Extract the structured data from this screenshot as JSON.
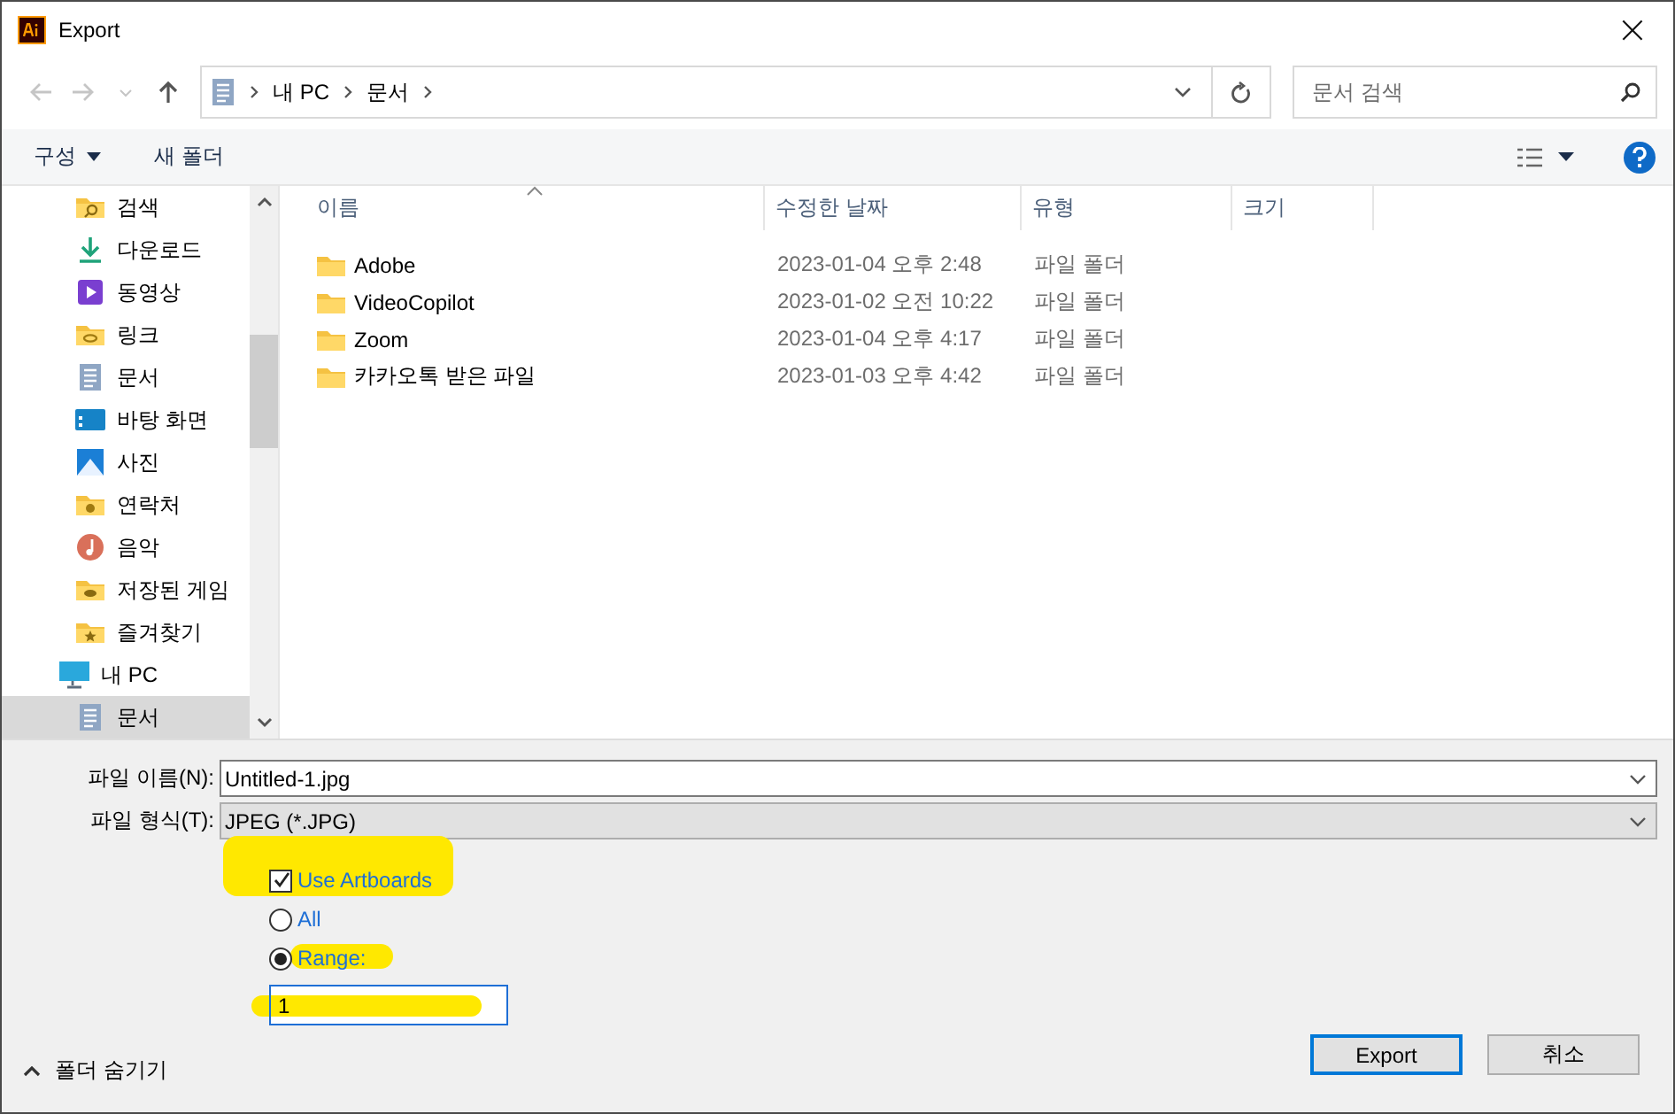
{
  "window": {
    "title": "Export",
    "close": "×"
  },
  "address": {
    "crumbs": [
      "내 PC",
      "문서"
    ]
  },
  "search": {
    "placeholder": "문서 검색"
  },
  "commands": {
    "organize": "구성",
    "new_folder": "새 폴더"
  },
  "nav": {
    "quick_access_items": [
      {
        "label": "검색",
        "selected": false
      },
      {
        "label": "다운로드",
        "selected": false
      },
      {
        "label": "동영상",
        "selected": false
      },
      {
        "label": "링크",
        "selected": false
      },
      {
        "label": "문서",
        "selected": false
      },
      {
        "label": "바탕 화면",
        "selected": false
      },
      {
        "label": "사진",
        "selected": false
      },
      {
        "label": "연락처",
        "selected": false
      },
      {
        "label": "음악",
        "selected": false
      },
      {
        "label": "저장된 게임",
        "selected": false
      },
      {
        "label": "즐겨찾기",
        "selected": false
      }
    ],
    "tree": [
      {
        "label": "내 PC",
        "selected": false,
        "children": [
          {
            "label": "문서",
            "selected": true
          }
        ]
      }
    ]
  },
  "table": {
    "columns": [
      "이름",
      "수정한 날짜",
      "유형",
      "크기"
    ],
    "rows": [
      {
        "name": "Adobe",
        "date": "2023-01-04 오후 2:48",
        "type": "파일 폴더"
      },
      {
        "name": "VideoCopilot",
        "date": "2023-01-02 오전 10:22",
        "type": "파일 폴더"
      },
      {
        "name": "Zoom",
        "date": "2023-01-04 오후 4:17",
        "type": "파일 폴더"
      },
      {
        "name": "카카오톡 받은 파일",
        "date": "2023-01-03 오후 4:42",
        "type": "파일 폴더"
      }
    ]
  },
  "file_name": {
    "label": "파일 이름(N):",
    "value": "Untitled-1.jpg"
  },
  "file_type": {
    "label": "파일 형식(T):",
    "value": "JPEG (*.JPG)"
  },
  "options": [
    {
      "kind": "checkbox",
      "label": "Use Artboards",
      "checked": true,
      "highlighted": true
    },
    {
      "kind": "radio",
      "label": "All",
      "selected": false,
      "highlighted": false
    },
    {
      "kind": "radio",
      "label": "Range:",
      "selected": true,
      "highlighted": true
    }
  ],
  "range": {
    "value": "1",
    "highlighted": true
  },
  "hide_folders": "폴더 숨기기",
  "buttons": [
    {
      "label": "Export",
      "default": true
    },
    {
      "label": "취소",
      "default": false
    }
  ]
}
